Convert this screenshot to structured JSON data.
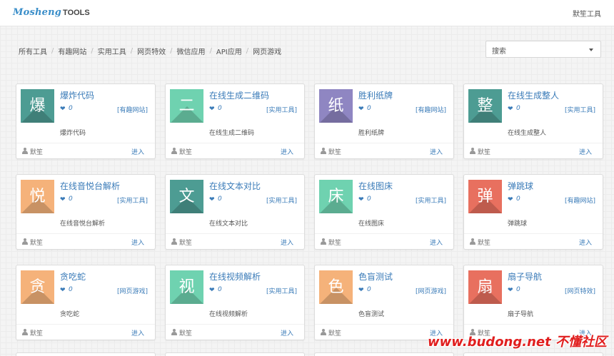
{
  "header": {
    "logo_script": "Mosheng",
    "logo_bold": "TOOLS",
    "user": "默笙工具"
  },
  "breadcrumb": [
    "所有工具",
    "有趣网站",
    "实用工具",
    "网页特效",
    "微信应用",
    "API应用",
    "网页游戏"
  ],
  "search": {
    "selected": "搜索"
  },
  "cards": [
    {
      "icon": "爆",
      "color": "#4d9c93",
      "title": "爆炸代码",
      "likes": "0",
      "category": "[有趣网站]",
      "desc": "爆炸代码",
      "author": "默笙",
      "action": "进入"
    },
    {
      "icon": "二",
      "color": "#6fd2b0",
      "title": "在线生成二维码",
      "likes": "0",
      "category": "[实用工具]",
      "desc": "在线生成二维码",
      "author": "默笙",
      "action": "进入"
    },
    {
      "icon": "纸",
      "color": "#8f86c2",
      "title": "胜利纸牌",
      "likes": "0",
      "category": "[有趣网站]",
      "desc": "胜利纸牌",
      "author": "默笙",
      "action": "进入"
    },
    {
      "icon": "整",
      "color": "#4d9c93",
      "title": "在线生成整人",
      "likes": "0",
      "category": "[实用工具]",
      "desc": "在线生成整人",
      "author": "默笙",
      "action": "进入"
    },
    {
      "icon": "悦",
      "color": "#f5b27a",
      "title": "在线音悦台解析",
      "likes": "0",
      "category": "[实用工具]",
      "desc": "在线音悦台解析",
      "author": "默笙",
      "action": "进入"
    },
    {
      "icon": "文",
      "color": "#4d9c93",
      "title": "在线文本对比",
      "likes": "0",
      "category": "[实用工具]",
      "desc": "在线文本对比",
      "author": "默笙",
      "action": "进入"
    },
    {
      "icon": "床",
      "color": "#6fd2b0",
      "title": "在线图床",
      "likes": "0",
      "category": "[实用工具]",
      "desc": "在线图床",
      "author": "默笙",
      "action": "进入"
    },
    {
      "icon": "弹",
      "color": "#e8705f",
      "title": "弹跳球",
      "likes": "0",
      "category": "[有趣网站]",
      "desc": "弹跳球",
      "author": "默笙",
      "action": "进入"
    },
    {
      "icon": "贪",
      "color": "#f5b27a",
      "title": "贪吃蛇",
      "likes": "0",
      "category": "[网页游戏]",
      "desc": "贪吃蛇",
      "author": "默笙",
      "action": "进入"
    },
    {
      "icon": "视",
      "color": "#6fd2b0",
      "title": "在线视频解析",
      "likes": "0",
      "category": "[实用工具]",
      "desc": "在线视频解析",
      "author": "默笙",
      "action": "进入"
    },
    {
      "icon": "色",
      "color": "#f5b27a",
      "title": "色盲测试",
      "likes": "0",
      "category": "[网页游戏]",
      "desc": "色盲测试",
      "author": "默笙",
      "action": "进入"
    },
    {
      "icon": "扇",
      "color": "#e8705f",
      "title": "扇子导航",
      "likes": "0",
      "category": "[网页特效]",
      "desc": "扇子导航",
      "author": "默笙",
      "action": "进入"
    }
  ],
  "watermark": "www.budong.net 不懂社区",
  "colors": {
    "link": "#3a7bb8",
    "logo": "#3a8ec9"
  },
  "icons": {
    "likes": "heart-icon",
    "author": "user-icon",
    "dropdown": "caret-down-icon"
  }
}
